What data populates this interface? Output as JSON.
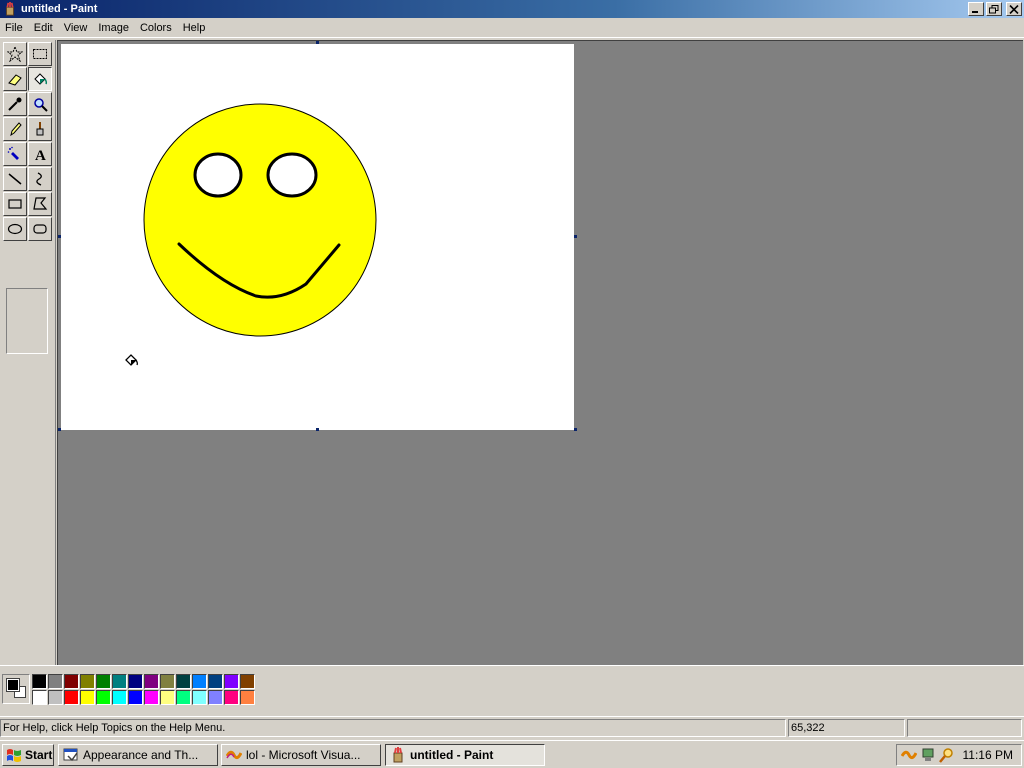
{
  "window": {
    "title": "untitled - Paint"
  },
  "menu": [
    "File",
    "Edit",
    "View",
    "Image",
    "Colors",
    "Help"
  ],
  "tools": [
    {
      "name": "free-form-select",
      "icon": "star-select-icon"
    },
    {
      "name": "select",
      "icon": "rect-select-icon"
    },
    {
      "name": "eraser",
      "icon": "eraser-icon"
    },
    {
      "name": "fill-with-color",
      "icon": "paint-bucket-icon",
      "selected": true
    },
    {
      "name": "pick-color",
      "icon": "eyedropper-icon"
    },
    {
      "name": "magnifier",
      "icon": "magnifier-icon"
    },
    {
      "name": "pencil",
      "icon": "pencil-icon"
    },
    {
      "name": "brush",
      "icon": "brush-icon"
    },
    {
      "name": "airbrush",
      "icon": "airbrush-icon"
    },
    {
      "name": "text",
      "icon": "text-icon"
    },
    {
      "name": "line",
      "icon": "line-icon"
    },
    {
      "name": "curve",
      "icon": "curve-icon"
    },
    {
      "name": "rectangle",
      "icon": "rectangle-icon"
    },
    {
      "name": "polygon",
      "icon": "polygon-icon"
    },
    {
      "name": "ellipse",
      "icon": "ellipse-icon"
    },
    {
      "name": "rounded-rectangle",
      "icon": "rounded-rect-icon"
    }
  ],
  "colors": {
    "foreground": "#000000",
    "background": "#ffffff",
    "face_fill": "#ffff00",
    "palette_top": [
      "#000000",
      "#808080",
      "#800000",
      "#808000",
      "#008000",
      "#008080",
      "#000080",
      "#800080",
      "#808040",
      "#004040",
      "#0080ff",
      "#004080",
      "#8000ff",
      "#804000"
    ],
    "palette_bottom": [
      "#ffffff",
      "#c0c0c0",
      "#ff0000",
      "#ffff00",
      "#00ff00",
      "#00ffff",
      "#0000ff",
      "#ff00ff",
      "#ffff80",
      "#00ff80",
      "#80ffff",
      "#8080ff",
      "#ff0080",
      "#ff8040"
    ]
  },
  "status": {
    "help": "For Help, click Help Topics on the Help Menu.",
    "coords": "65,322",
    "size": ""
  },
  "taskbar": {
    "start": "Start",
    "tasks": [
      {
        "label": "Appearance and Th...",
        "icon": "control-panel-icon",
        "active": false
      },
      {
        "label": "lol - Microsoft Visua...",
        "icon": "visual-studio-icon",
        "active": false
      },
      {
        "label": "untitled - Paint",
        "icon": "paint-icon",
        "active": true
      }
    ],
    "clock": "11:16 PM"
  }
}
